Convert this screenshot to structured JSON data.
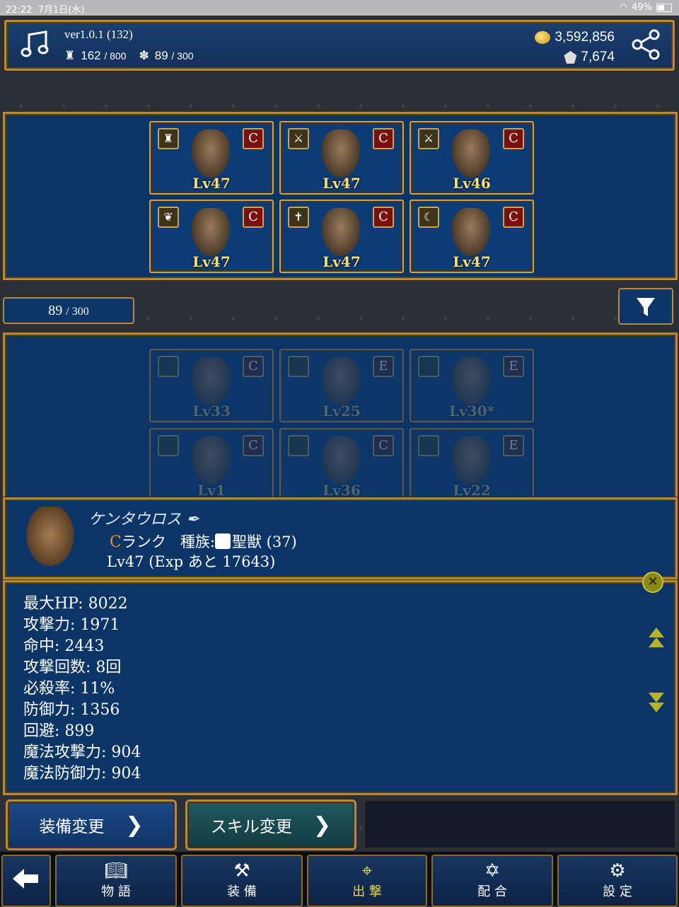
{
  "status_bar": {
    "time": "22:22",
    "date": "7月1日(水)",
    "battery": "49%"
  },
  "header": {
    "version": "ver1.0.1 (132)",
    "castle_count": "162",
    "castle_max": "/ 800",
    "monster_count": "89",
    "monster_max": "/ 300",
    "gold": "3,592,856",
    "gems": "7,674",
    "icons": {
      "music": "music-note-icon",
      "share": "share-icon"
    }
  },
  "team": [
    {
      "level": "Lv47",
      "rank": "C",
      "role_icon": "castle-icon"
    },
    {
      "level": "Lv47",
      "rank": "C",
      "role_icon": "sword-icon"
    },
    {
      "level": "Lv46",
      "rank": "C",
      "role_icon": "sword-icon"
    },
    {
      "level": "Lv47",
      "rank": "C",
      "role_icon": "wing-icon"
    },
    {
      "level": "Lv47",
      "rank": "C",
      "role_icon": "cross-icon"
    },
    {
      "level": "Lv47",
      "rank": "C",
      "role_icon": "scythe-icon"
    }
  ],
  "box_count": {
    "current": "89",
    "max": "/ 300"
  },
  "box": [
    {
      "level": "Lv33",
      "rank": "C"
    },
    {
      "level": "Lv25",
      "rank": "E"
    },
    {
      "level": "Lv30*",
      "rank": "E"
    },
    {
      "level": "Lv1",
      "rank": "C"
    },
    {
      "level": "Lv36",
      "rank": "C"
    },
    {
      "level": "Lv22",
      "rank": "E"
    }
  ],
  "detail": {
    "name": "ケンタウロス",
    "rank": "C",
    "rank_label": "ランク",
    "tribe_label": "種族:",
    "tribe": "聖獣 (37)",
    "level_line": "Lv47  (Exp あと 17643)"
  },
  "stats": [
    "最大HP: 8022",
    "攻撃力: 1971",
    "命中: 2443",
    "攻撃回数: 8回",
    "必殺率: 11%",
    "防御力: 1356",
    "回避: 899",
    "魔法攻撃力: 904",
    "魔法防御力: 904"
  ],
  "actions": {
    "equip": "装備変更",
    "skill": "スキル変更"
  },
  "nav": [
    {
      "label": "物 語",
      "icon": "book-icon"
    },
    {
      "label": "装 備",
      "icon": "anvil-icon"
    },
    {
      "label": "出 撃",
      "icon": "compass-icon"
    },
    {
      "label": "配 合",
      "icon": "hexagram-icon"
    },
    {
      "label": "設 定",
      "icon": "gear-icon"
    }
  ],
  "colors": {
    "panel": "#0c3567",
    "gold_frame": "#b48a3c",
    "level_text": "#f4e07a",
    "rank_c": "#f08a2a",
    "active_nav": "#e8d060"
  }
}
